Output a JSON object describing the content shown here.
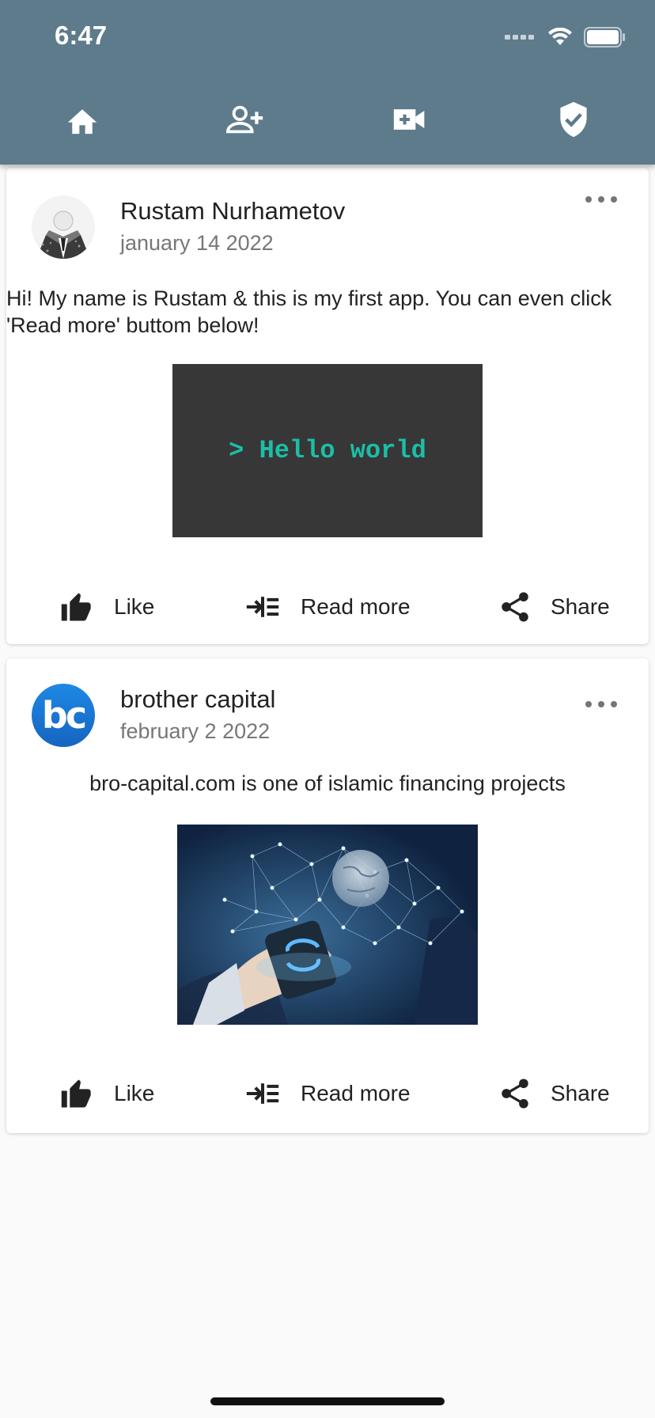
{
  "status_bar": {
    "time": "6:47"
  },
  "tabs": [
    {
      "name": "home",
      "icon": "home-icon"
    },
    {
      "name": "add-friend",
      "icon": "person-add-icon"
    },
    {
      "name": "video",
      "icon": "video-camera-icon"
    },
    {
      "name": "security",
      "icon": "shield-check-icon"
    }
  ],
  "colors": {
    "appbar": "#5e7b8c",
    "background": "#fafafa",
    "terminal_bg": "#373737",
    "terminal_text": "#1bbfa7"
  },
  "posts": [
    {
      "author": "Rustam Nurhametov",
      "date": "january 14 2022",
      "text": "Hi! My name is Rustam & this is my first app. You can even click 'Read more' buttom below!",
      "image_text": "> Hello world",
      "actions": {
        "like": "Like",
        "read_more": "Read more",
        "share": "Share"
      }
    },
    {
      "author": "brother capital",
      "date": "february 2 2022",
      "text": "bro-capital.com is one of islamic financing projects",
      "avatar_text": "bc",
      "actions": {
        "like": "Like",
        "read_more": "Read more",
        "share": "Share"
      }
    }
  ]
}
